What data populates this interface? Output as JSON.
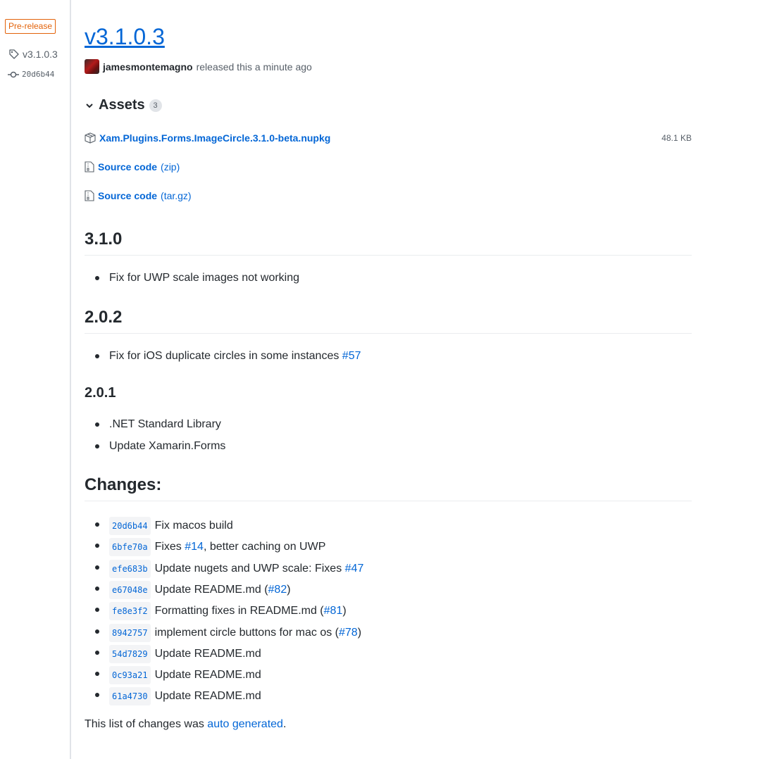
{
  "sidebar": {
    "badge": "Pre-release",
    "tag": "v3.1.0.3",
    "commit": "20d6b44"
  },
  "release": {
    "title": "v3.1.0.3",
    "author": "jamesmontemagno",
    "released_text": "released this a minute ago"
  },
  "assets": {
    "title": "Assets",
    "count": "3",
    "items": [
      {
        "name": "Xam.Plugins.Forms.ImageCircle.3.1.0-beta.nupkg",
        "ext": "",
        "size": "48.1 KB"
      },
      {
        "name": "Source code",
        "ext": "(zip)",
        "size": ""
      },
      {
        "name": "Source code",
        "ext": "(tar.gz)",
        "size": ""
      }
    ]
  },
  "notes": {
    "s1": {
      "heading": "3.1.0",
      "items": [
        "Fix for UWP scale images not working"
      ]
    },
    "s2": {
      "heading": "2.0.2",
      "item_text": "Fix for iOS duplicate circles in some instances",
      "item_link": "#57"
    },
    "s3": {
      "heading": "2.0.1",
      "items": [
        ".NET Standard Library",
        "Update Xamarin.Forms"
      ]
    }
  },
  "changes": {
    "heading": "Changes:",
    "items": [
      {
        "sha": "20d6b44",
        "pre": "Fix macos build",
        "link": "",
        "post": ""
      },
      {
        "sha": "6bfe70a",
        "pre": "Fixes ",
        "link": "#14",
        "post": ", better caching on UWP"
      },
      {
        "sha": "efe683b",
        "pre": "Update nugets and UWP scale: Fixes ",
        "link": "#47",
        "post": ""
      },
      {
        "sha": "e67048e",
        "pre": "Update README.md (",
        "link": "#82",
        "post": ")"
      },
      {
        "sha": "fe8e3f2",
        "pre": "Formatting fixes in README.md (",
        "link": "#81",
        "post": ")"
      },
      {
        "sha": "8942757",
        "pre": "implement circle buttons for mac os (",
        "link": "#78",
        "post": ")"
      },
      {
        "sha": "54d7829",
        "pre": "Update README.md",
        "link": "",
        "post": ""
      },
      {
        "sha": "0c93a21",
        "pre": "Update README.md",
        "link": "",
        "post": ""
      },
      {
        "sha": "61a4730",
        "pre": "Update README.md",
        "link": "",
        "post": ""
      }
    ],
    "footer_text": "This list of changes was ",
    "footer_link": "auto generated",
    "footer_end": "."
  }
}
